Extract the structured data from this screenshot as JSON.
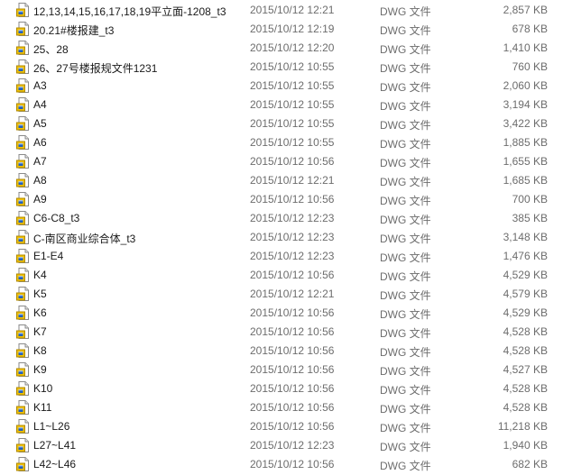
{
  "colors": {
    "name_text": "#1a1a1a",
    "meta_text": "#6d6d6d",
    "icon_page": "#ffffff",
    "icon_border": "#8a8a8a",
    "icon_accent_yellow": "#f2c200",
    "icon_accent_blue": "#1f5fbf"
  },
  "icon_name": "dwg-file-icon",
  "files": [
    {
      "name": "12,13,14,15,16,17,18,19平立面-1208_t3",
      "modified": "2015/10/12 12:21",
      "type": "DWG 文件",
      "size": "2,857 KB"
    },
    {
      "name": "20.21#楼报建_t3",
      "modified": "2015/10/12 12:19",
      "type": "DWG 文件",
      "size": "678 KB"
    },
    {
      "name": "25、28",
      "modified": "2015/10/12 12:20",
      "type": "DWG 文件",
      "size": "1,410 KB"
    },
    {
      "name": "26、27号楼报规文件1231",
      "modified": "2015/10/12 10:55",
      "type": "DWG 文件",
      "size": "760 KB"
    },
    {
      "name": "A3",
      "modified": "2015/10/12 10:55",
      "type": "DWG 文件",
      "size": "2,060 KB"
    },
    {
      "name": "A4",
      "modified": "2015/10/12 10:55",
      "type": "DWG 文件",
      "size": "3,194 KB"
    },
    {
      "name": "A5",
      "modified": "2015/10/12 10:55",
      "type": "DWG 文件",
      "size": "3,422 KB"
    },
    {
      "name": "A6",
      "modified": "2015/10/12 10:55",
      "type": "DWG 文件",
      "size": "1,885 KB"
    },
    {
      "name": "A7",
      "modified": "2015/10/12 10:56",
      "type": "DWG 文件",
      "size": "1,655 KB"
    },
    {
      "name": "A8",
      "modified": "2015/10/12 12:21",
      "type": "DWG 文件",
      "size": "1,685 KB"
    },
    {
      "name": "A9",
      "modified": "2015/10/12 10:56",
      "type": "DWG 文件",
      "size": "700 KB"
    },
    {
      "name": "C6-C8_t3",
      "modified": "2015/10/12 12:23",
      "type": "DWG 文件",
      "size": "385 KB"
    },
    {
      "name": "C-南区商业综合体_t3",
      "modified": "2015/10/12 12:23",
      "type": "DWG 文件",
      "size": "3,148 KB"
    },
    {
      "name": "E1-E4",
      "modified": "2015/10/12 12:23",
      "type": "DWG 文件",
      "size": "1,476 KB"
    },
    {
      "name": "K4",
      "modified": "2015/10/12 10:56",
      "type": "DWG 文件",
      "size": "4,529 KB"
    },
    {
      "name": "K5",
      "modified": "2015/10/12 12:21",
      "type": "DWG 文件",
      "size": "4,579 KB"
    },
    {
      "name": "K6",
      "modified": "2015/10/12 10:56",
      "type": "DWG 文件",
      "size": "4,529 KB"
    },
    {
      "name": "K7",
      "modified": "2015/10/12 10:56",
      "type": "DWG 文件",
      "size": "4,528 KB"
    },
    {
      "name": "K8",
      "modified": "2015/10/12 10:56",
      "type": "DWG 文件",
      "size": "4,528 KB"
    },
    {
      "name": "K9",
      "modified": "2015/10/12 10:56",
      "type": "DWG 文件",
      "size": "4,527 KB"
    },
    {
      "name": "K10",
      "modified": "2015/10/12 10:56",
      "type": "DWG 文件",
      "size": "4,528 KB"
    },
    {
      "name": "K11",
      "modified": "2015/10/12 10:56",
      "type": "DWG 文件",
      "size": "4,528 KB"
    },
    {
      "name": "L1~L26",
      "modified": "2015/10/12 10:56",
      "type": "DWG 文件",
      "size": "11,218 KB"
    },
    {
      "name": "L27~L41",
      "modified": "2015/10/12 12:23",
      "type": "DWG 文件",
      "size": "1,940 KB"
    },
    {
      "name": "L42~L46",
      "modified": "2015/10/12 10:56",
      "type": "DWG 文件",
      "size": "682 KB"
    }
  ]
}
